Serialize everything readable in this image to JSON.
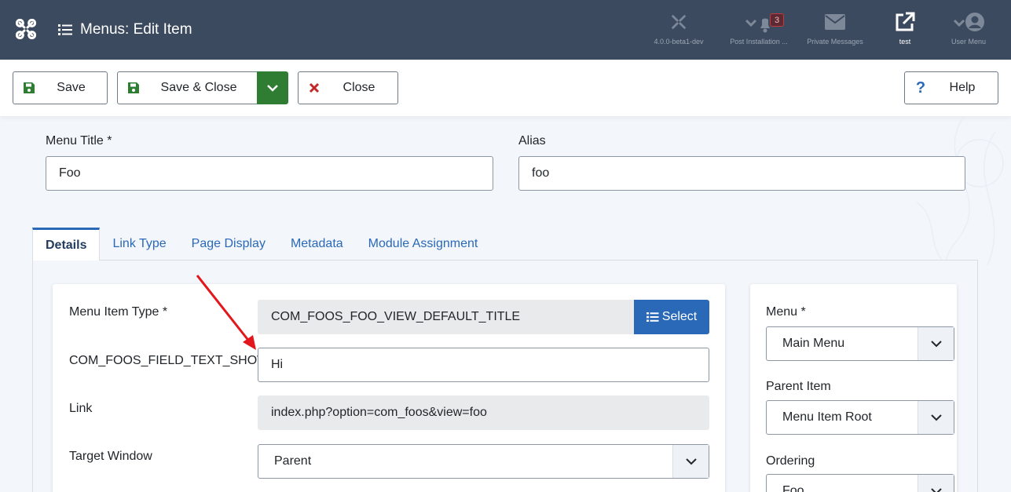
{
  "header": {
    "title": "Menus: Edit Item",
    "items": [
      {
        "label": "4.0.0-beta1-dev",
        "icon": "joomla-icon"
      },
      {
        "label": "Post Installation ...",
        "icon": "bell-icon",
        "badge": "3"
      },
      {
        "label": "Private Messages",
        "icon": "envelope-icon"
      },
      {
        "label": "test",
        "icon": "external-link-icon"
      },
      {
        "label": "User Menu",
        "icon": "user-icon"
      }
    ]
  },
  "toolbar": {
    "save_label": "Save",
    "save_close_label": "Save & Close",
    "close_label": "Close",
    "help_label": "Help"
  },
  "form": {
    "menu_title_label": "Menu Title *",
    "menu_title_value": "Foo",
    "alias_label": "Alias",
    "alias_value": "foo"
  },
  "tabs": [
    "Details",
    "Link Type",
    "Page Display",
    "Metadata",
    "Module Assignment"
  ],
  "details": {
    "item_type_label": "Menu Item Type *",
    "item_type_value": "COM_FOOS_FOO_VIEW_DEFAULT_TITLE",
    "select_label": "Select",
    "show_text_label": "COM_FOOS_FIELD_TEXT_SHOW_L",
    "show_text_value": "Hi",
    "link_label": "Link",
    "link_value": "index.php?option=com_foos&view=foo",
    "target_label": "Target Window",
    "target_value": "Parent"
  },
  "sidebar": {
    "menu_label": "Menu *",
    "menu_value": "Main Menu",
    "parent_label": "Parent Item",
    "parent_value": "Menu Item Root",
    "ordering_label": "Ordering",
    "ordering_value": "Foo"
  },
  "colors": {
    "header_bg": "#3b4a5e",
    "primary": "#2a69b8",
    "success": "#2f7d32",
    "danger": "#c52828",
    "annotation_arrow": "#e3171b"
  }
}
